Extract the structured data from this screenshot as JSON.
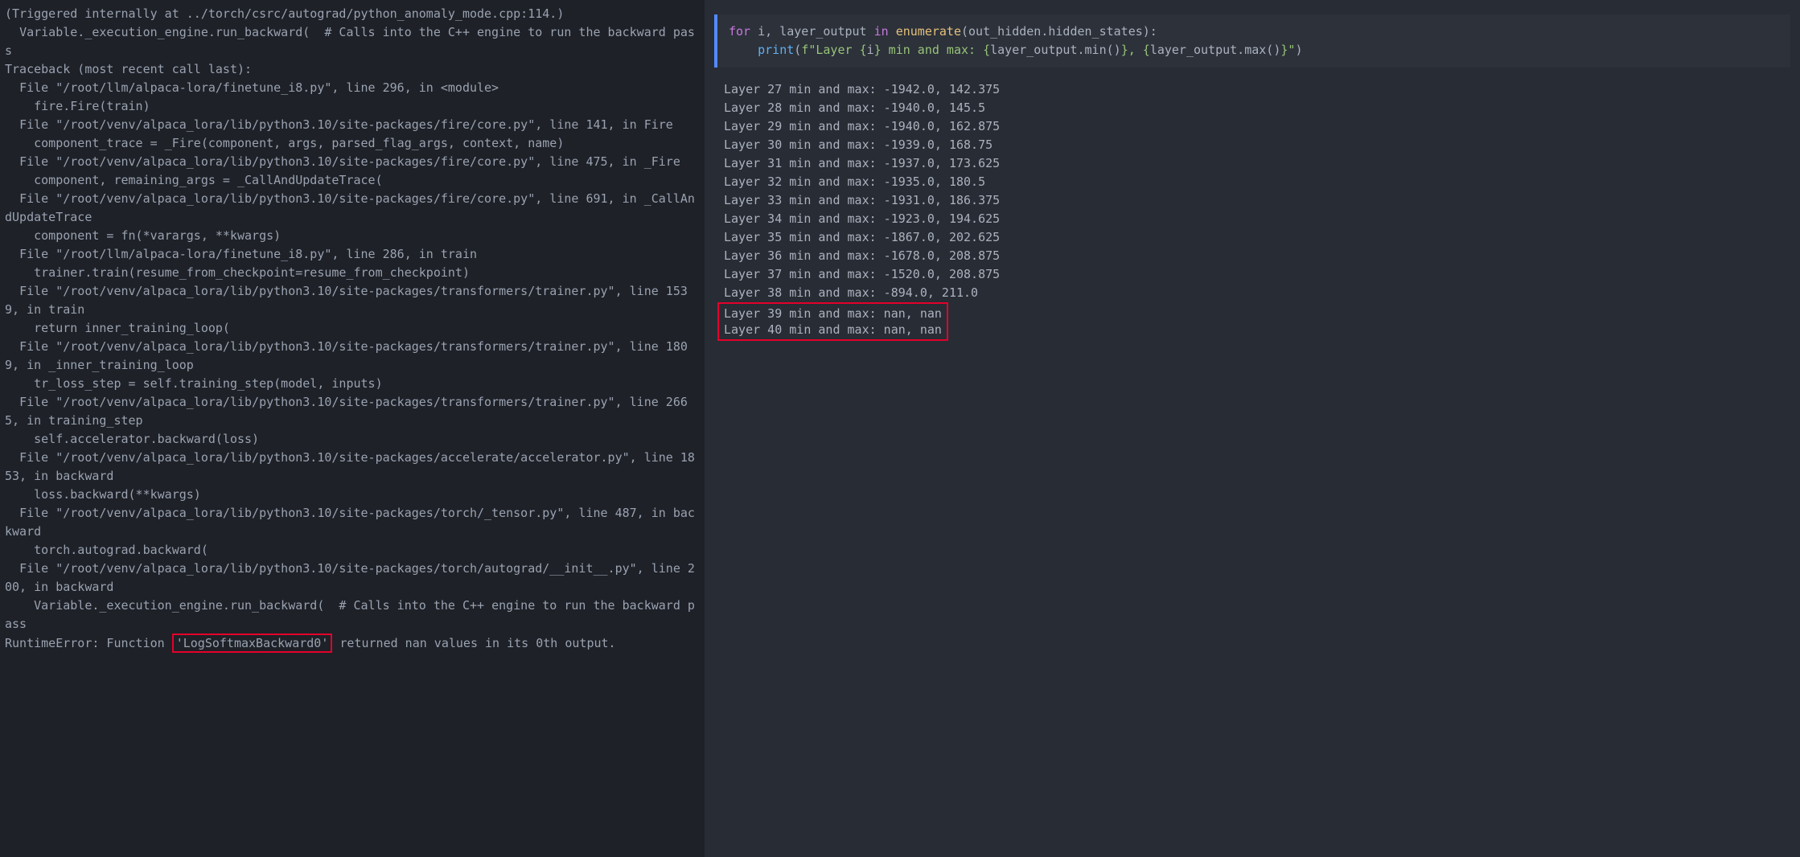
{
  "traceback": {
    "lines": [
      "(Triggered internally at ../torch/csrc/autograd/python_anomaly_mode.cpp:114.)",
      "  Variable._execution_engine.run_backward(  # Calls into the C++ engine to run the backward pass",
      "Traceback (most recent call last):",
      "  File \"/root/llm/alpaca-lora/finetune_i8.py\", line 296, in <module>",
      "    fire.Fire(train)",
      "  File \"/root/venv/alpaca_lora/lib/python3.10/site-packages/fire/core.py\", line 141, in Fire",
      "    component_trace = _Fire(component, args, parsed_flag_args, context, name)",
      "  File \"/root/venv/alpaca_lora/lib/python3.10/site-packages/fire/core.py\", line 475, in _Fire",
      "    component, remaining_args = _CallAndUpdateTrace(",
      "  File \"/root/venv/alpaca_lora/lib/python3.10/site-packages/fire/core.py\", line 691, in _CallAndUpdateTrace",
      "    component = fn(*varargs, **kwargs)",
      "  File \"/root/llm/alpaca-lora/finetune_i8.py\", line 286, in train",
      "    trainer.train(resume_from_checkpoint=resume_from_checkpoint)",
      "  File \"/root/venv/alpaca_lora/lib/python3.10/site-packages/transformers/trainer.py\", line 1539, in train",
      "    return inner_training_loop(",
      "  File \"/root/venv/alpaca_lora/lib/python3.10/site-packages/transformers/trainer.py\", line 1809, in _inner_training_loop",
      "    tr_loss_step = self.training_step(model, inputs)",
      "  File \"/root/venv/alpaca_lora/lib/python3.10/site-packages/transformers/trainer.py\", line 2665, in training_step",
      "    self.accelerator.backward(loss)",
      "  File \"/root/venv/alpaca_lora/lib/python3.10/site-packages/accelerate/accelerator.py\", line 1853, in backward",
      "    loss.backward(**kwargs)",
      "  File \"/root/venv/alpaca_lora/lib/python3.10/site-packages/torch/_tensor.py\", line 487, in backward",
      "    torch.autograd.backward(",
      "  File \"/root/venv/alpaca_lora/lib/python3.10/site-packages/torch/autograd/__init__.py\", line 200, in backward",
      "    Variable._execution_engine.run_backward(  # Calls into the C++ engine to run the backward pass"
    ],
    "final_prefix": "RuntimeError: Function ",
    "final_hl": "'LogSoftmaxBackward0'",
    "final_suffix": " returned nan values in its 0th output."
  },
  "code": {
    "kw_for": "for",
    "var_i": " i",
    "comma": ", layer_output ",
    "kw_in": "in",
    "space": " ",
    "fn_enum": "enumerate",
    "args": "(out_hidden.hidden_states):",
    "indent": "    ",
    "fn_print": "print",
    "lparen": "(",
    "fstr_prefix": "f\"Layer ",
    "lbrace1": "{",
    "fvar_i": "i",
    "rbrace1": "}",
    "mid": " min and max: ",
    "lbrace2": "{",
    "expr_min": "layer_output.min()",
    "rbrace2": "}",
    "sep": ", ",
    "lbrace3": "{",
    "expr_max": "layer_output.max()",
    "rbrace3": "}",
    "fstr_end": "\"",
    "rparen": ")"
  },
  "output": {
    "normal_lines": [
      "Layer 27 min and max: -1942.0, 142.375",
      "Layer 28 min and max: -1940.0, 145.5",
      "Layer 29 min and max: -1940.0, 162.875",
      "Layer 30 min and max: -1939.0, 168.75",
      "Layer 31 min and max: -1937.0, 173.625",
      "Layer 32 min and max: -1935.0, 180.5",
      "Layer 33 min and max: -1931.0, 186.375",
      "Layer 34 min and max: -1923.0, 194.625",
      "Layer 35 min and max: -1867.0, 202.625",
      "Layer 36 min and max: -1678.0, 208.875",
      "Layer 37 min and max: -1520.0, 208.875",
      "Layer 38 min and max: -894.0, 211.0"
    ],
    "hl_lines": [
      "Layer 39 min and max: nan, nan",
      "Layer 40 min and max: nan, nan"
    ]
  },
  "chart_data": {
    "type": "table",
    "title": "Per-layer min/max of out_hidden.hidden_states",
    "columns": [
      "layer",
      "min",
      "max"
    ],
    "rows": [
      [
        27,
        -1942.0,
        142.375
      ],
      [
        28,
        -1940.0,
        145.5
      ],
      [
        29,
        -1940.0,
        162.875
      ],
      [
        30,
        -1939.0,
        168.75
      ],
      [
        31,
        -1937.0,
        173.625
      ],
      [
        32,
        -1935.0,
        180.5
      ],
      [
        33,
        -1931.0,
        186.375
      ],
      [
        34,
        -1923.0,
        194.625
      ],
      [
        35,
        -1867.0,
        202.625
      ],
      [
        36,
        -1678.0,
        208.875
      ],
      [
        37,
        -1520.0,
        208.875
      ],
      [
        38,
        -894.0,
        211.0
      ],
      [
        39,
        "nan",
        "nan"
      ],
      [
        40,
        "nan",
        "nan"
      ]
    ]
  }
}
